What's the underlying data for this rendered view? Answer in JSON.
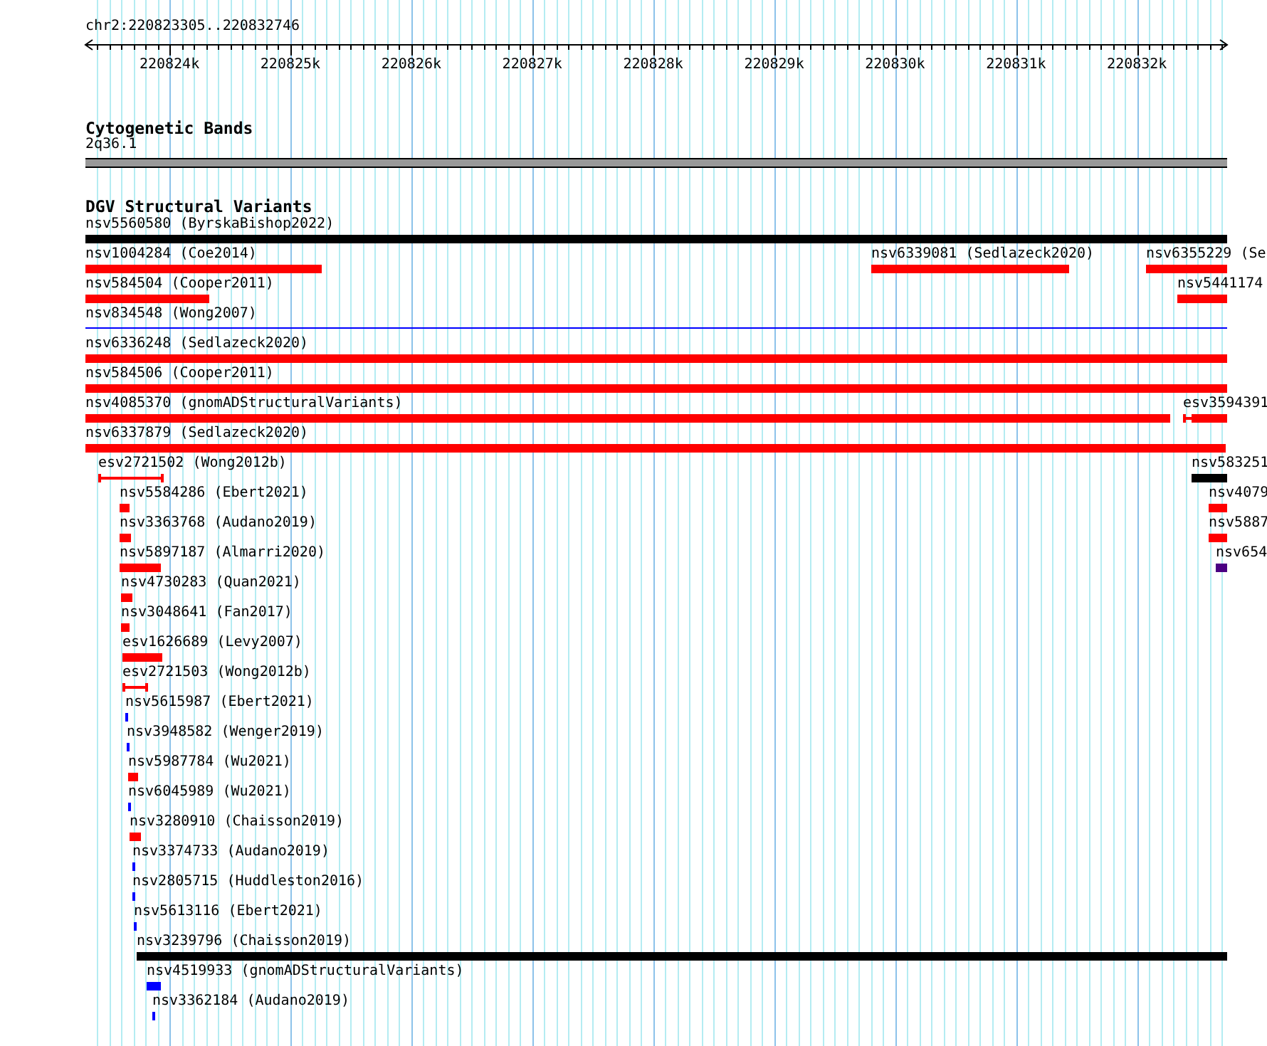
{
  "ruler": {
    "location": "chr2:220823305..220832746",
    "ticks": [
      "220824k",
      "220825k",
      "220826k",
      "220827k",
      "220828k",
      "220829k",
      "220830k",
      "220831k",
      "220832k"
    ]
  },
  "tracks": [
    {
      "title": "Cytogenetic Bands",
      "kind": "bands",
      "features": [
        {
          "label": "2q36.1",
          "color": "#999999"
        }
      ]
    },
    {
      "title": "DGV Structural Variants",
      "kind": "variants",
      "features": [
        {
          "label": "nsv5560580 (ByrskaBishop2022)",
          "kind": "bar",
          "color": "#000000"
        },
        {
          "label": "nsv1004284 (Coe2014)",
          "kind": "bar",
          "color": "#ff0000"
        },
        {
          "label": "nsv6339081 (Sedlazeck2020)",
          "kind": "bar",
          "color": "#ff0000"
        },
        {
          "label": "nsv6355229 (Se",
          "kind": "bar",
          "color": "#ff0000"
        },
        {
          "label": "nsv584504 (Cooper2011)",
          "kind": "bar",
          "color": "#ff0000"
        },
        {
          "label": "nsv5441174",
          "kind": "bar",
          "color": "#ff0000"
        },
        {
          "label": "nsv834548 (Wong2007)",
          "kind": "line",
          "color": "#0000ff"
        },
        {
          "label": "nsv6336248 (Sedlazeck2020)",
          "kind": "bar",
          "color": "#ff0000"
        },
        {
          "label": "nsv584506 (Cooper2011)",
          "kind": "bar",
          "color": "#ff0000"
        },
        {
          "label": "nsv4085370 (gnomADStructuralVariants)",
          "kind": "bar",
          "color": "#ff0000"
        },
        {
          "label": "esv3594391",
          "kind": "split",
          "color": "#ff0000"
        },
        {
          "label": "nsv6337879 (Sedlazeck2020)",
          "kind": "bar",
          "color": "#ff0000"
        },
        {
          "label": "esv2721502 (Wong2012b)",
          "kind": "range",
          "color": "#ff0000"
        },
        {
          "label": "nsv583251",
          "kind": "bar",
          "color": "#000000"
        },
        {
          "label": "nsv5584286 (Ebert2021)",
          "kind": "bar",
          "color": "#ff0000"
        },
        {
          "label": "nsv4079",
          "kind": "bar",
          "color": "#ff0000"
        },
        {
          "label": "nsv3363768 (Audano2019)",
          "kind": "bar",
          "color": "#ff0000"
        },
        {
          "label": "nsv5887",
          "kind": "bar",
          "color": "#ff0000"
        },
        {
          "label": "nsv5897187 (Almarri2020)",
          "kind": "bar",
          "color": "#ff0000"
        },
        {
          "label": "nsv654",
          "kind": "bar",
          "color": "#4b0082"
        },
        {
          "label": "nsv4730283 (Quan2021)",
          "kind": "bar",
          "color": "#ff0000"
        },
        {
          "label": "nsv3048641 (Fan2017)",
          "kind": "bar",
          "color": "#ff0000"
        },
        {
          "label": "esv1626689 (Levy2007)",
          "kind": "bar",
          "color": "#ff0000"
        },
        {
          "label": "esv2721503 (Wong2012b)",
          "kind": "range",
          "color": "#ff0000"
        },
        {
          "label": "nsv5615987 (Ebert2021)",
          "kind": "bar",
          "color": "#0000ff"
        },
        {
          "label": "nsv3948582 (Wenger2019)",
          "kind": "bar",
          "color": "#0000ff"
        },
        {
          "label": "nsv5987784 (Wu2021)",
          "kind": "bar",
          "color": "#ff0000"
        },
        {
          "label": "nsv6045989 (Wu2021)",
          "kind": "bar",
          "color": "#0000ff"
        },
        {
          "label": "nsv3280910 (Chaisson2019)",
          "kind": "bar",
          "color": "#ff0000"
        },
        {
          "label": "nsv3374733 (Audano2019)",
          "kind": "bar",
          "color": "#0000ff"
        },
        {
          "label": "nsv2805715 (Huddleston2016)",
          "kind": "bar",
          "color": "#0000ff"
        },
        {
          "label": "nsv5613116 (Ebert2021)",
          "kind": "bar",
          "color": "#0000ff"
        },
        {
          "label": "nsv3239796 (Chaisson2019)",
          "kind": "bar",
          "color": "#000000"
        },
        {
          "label": "nsv4519933 (gnomADStructuralVariants)",
          "kind": "bar",
          "color": "#0000ff"
        },
        {
          "label": "nsv3362184 (Audano2019)",
          "kind": "bar",
          "color": "#0000ff"
        }
      ]
    }
  ]
}
